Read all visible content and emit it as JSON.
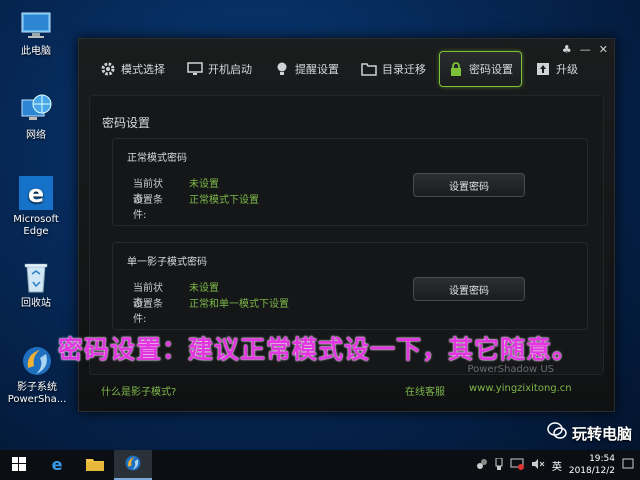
{
  "desktop": {
    "icons": [
      {
        "label": "此电脑",
        "icon": "computer-icon"
      },
      {
        "label": "网络",
        "icon": "network-globe-icon"
      },
      {
        "label": "Microsoft Edge",
        "icon": "edge-icon"
      },
      {
        "label": "回收站",
        "icon": "recycle-bin-icon"
      },
      {
        "label": "影子系统 PowerSha...",
        "icon": "shadow-system-icon"
      }
    ]
  },
  "window": {
    "controls": [
      "♣",
      "—",
      "✕"
    ],
    "tabs": [
      {
        "label": "模式选择",
        "icon": "gear-icon",
        "active": false
      },
      {
        "label": "开机启动",
        "icon": "monitor-icon",
        "active": false
      },
      {
        "label": "提醒设置",
        "icon": "bulb-icon",
        "active": false
      },
      {
        "label": "目录迁移",
        "icon": "folder-icon",
        "active": false
      },
      {
        "label": "密码设置",
        "icon": "lock-icon",
        "active": true
      },
      {
        "label": "升级",
        "icon": "upgrade-icon",
        "active": false
      }
    ],
    "panel_title": "密码设置",
    "cards": [
      {
        "title": "正常模式密码",
        "status_key": "当前状态:",
        "status_value": "未设置",
        "cond_key": "设置条件:",
        "cond_value": "正常模式下设置",
        "button": "设置密码"
      },
      {
        "title": "单一影子模式密码",
        "status_key": "当前状态:",
        "status_value": "未设置",
        "cond_key": "设置条件:",
        "cond_value": "正常和单一模式下设置",
        "button": "设置密码"
      }
    ],
    "footer": {
      "help_link": "什么是影子模式?",
      "service_link": "在线客服",
      "website_link": "www.yingzixitong.cn"
    },
    "logo_text": "PowerShadow US"
  },
  "caption": "密码设置：建议正常模式设一下，其它随意。",
  "watermark": "玩转电脑",
  "taskbar": {
    "ime": "英",
    "time": "19:54",
    "date": "2018/12/2"
  },
  "colors": {
    "accent_green": "#7ec23a",
    "caption_magenta": "#e236e0"
  }
}
